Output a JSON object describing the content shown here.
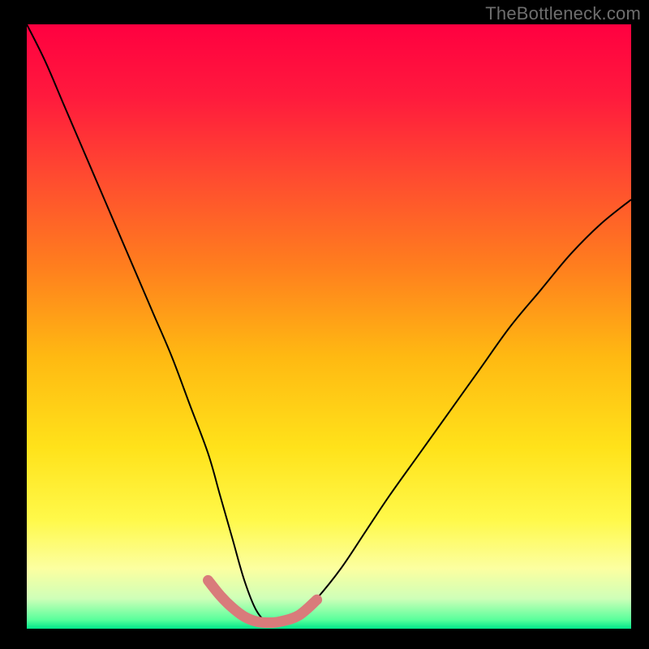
{
  "watermark": "TheBottleneck.com",
  "chart_data": {
    "type": "line",
    "title": "",
    "xlabel": "",
    "ylabel": "",
    "xlim": [
      0,
      100
    ],
    "ylim": [
      0,
      100
    ],
    "background": {
      "type": "vertical-gradient",
      "stops": [
        {
          "pos": 0.0,
          "color": "#ff0040"
        },
        {
          "pos": 0.12,
          "color": "#ff1a3d"
        },
        {
          "pos": 0.25,
          "color": "#ff4a30"
        },
        {
          "pos": 0.4,
          "color": "#ff7e1e"
        },
        {
          "pos": 0.55,
          "color": "#ffb912"
        },
        {
          "pos": 0.7,
          "color": "#ffe21a"
        },
        {
          "pos": 0.82,
          "color": "#fff94a"
        },
        {
          "pos": 0.9,
          "color": "#fcffa0"
        },
        {
          "pos": 0.95,
          "color": "#cfffb8"
        },
        {
          "pos": 0.985,
          "color": "#5aff9c"
        },
        {
          "pos": 1.0,
          "color": "#00e58a"
        }
      ]
    },
    "series": [
      {
        "name": "bottleneck-curve",
        "color": "#000000",
        "stroke_width": 2,
        "x": [
          0,
          3,
          6,
          9,
          12,
          15,
          18,
          21,
          24,
          27,
          30,
          32,
          34,
          36,
          38,
          40,
          42,
          45,
          48,
          52,
          56,
          60,
          65,
          70,
          75,
          80,
          85,
          90,
          95,
          100
        ],
        "y": [
          100,
          94,
          87,
          80,
          73,
          66,
          59,
          52,
          45,
          37,
          29,
          22,
          15,
          8,
          3,
          1,
          1,
          2,
          5,
          10,
          16,
          22,
          29,
          36,
          43,
          50,
          56,
          62,
          67,
          71
        ]
      },
      {
        "name": "valley-highlight",
        "color": "#d97b7b",
        "stroke_width": 13,
        "linecap": "round",
        "x": [
          30,
          32,
          34,
          36,
          38,
          40,
          42,
          45,
          48
        ],
        "y": [
          8,
          5.5,
          3.5,
          2.0,
          1.2,
          1.0,
          1.2,
          2.2,
          4.8
        ]
      }
    ]
  }
}
